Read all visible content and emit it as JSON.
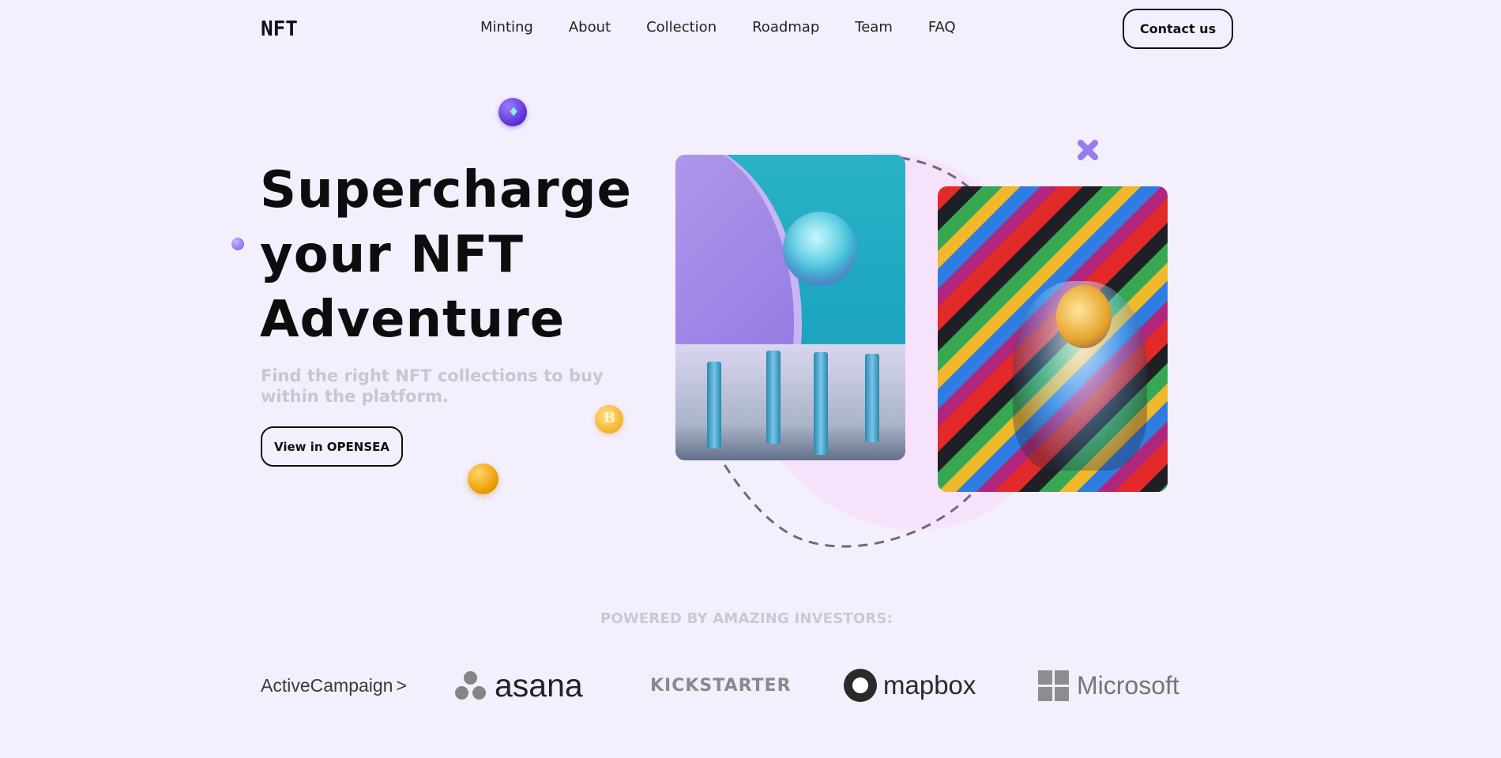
{
  "header": {
    "logo": "NFT",
    "nav": [
      "Minting",
      "About",
      "Collection",
      "Roadmap",
      "Team",
      "FAQ"
    ],
    "contact_label": "Contact us"
  },
  "hero": {
    "title_lines": [
      "Supercharge",
      "your NFT",
      "Adventure"
    ],
    "subtitle": "Find the right NFT collections to buy within the platform.",
    "cta_label": "View in OPENSEA"
  },
  "investors": {
    "label": "POWERED BY AMAZING INVESTORS:",
    "brands": {
      "activecampaign": "ActiveCampaign",
      "activecampaign_chevron": ">",
      "asana": "asana",
      "kickstarter": "KICKSTARTER",
      "mapbox": "mapbox",
      "microsoft": "Microsoft"
    }
  },
  "icons": {
    "eth_coin": "ethereum-coin-icon",
    "btc_coin": "bitcoin-coin-icon",
    "btc_glyph": "B",
    "eth_glyph": "♦"
  },
  "colors": {
    "background": "#f3effd",
    "text": "#111111",
    "muted": "#c9c5d3",
    "accent_purple": "#5a2fd0",
    "accent_gold": "#f0a20a",
    "blob_pink": "#f7e2fb"
  }
}
